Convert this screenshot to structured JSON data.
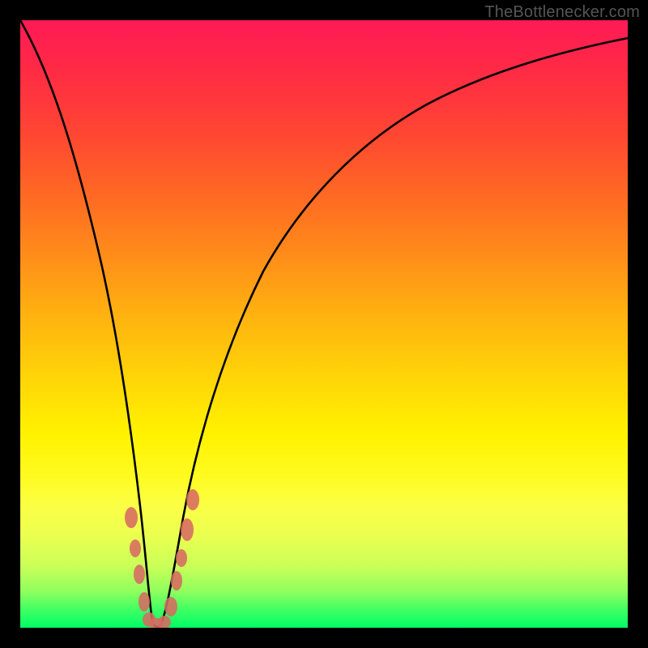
{
  "watermark": "TheBottlenecker.com",
  "chart_data": {
    "type": "line",
    "title": "",
    "xlabel": "",
    "ylabel": "",
    "xlim": [
      0,
      100
    ],
    "ylim": [
      0,
      100
    ],
    "grid": false,
    "legend": null,
    "series": [
      {
        "name": "bottleneck-curve",
        "x": [
          0,
          2,
          5,
          8,
          11,
          14,
          16,
          18,
          19.5,
          20.8,
          22,
          23,
          24,
          26,
          29,
          33,
          38,
          44,
          51,
          59,
          68,
          78,
          89,
          100
        ],
        "y": [
          100,
          90,
          76,
          62,
          48,
          34,
          23,
          12,
          5,
          0.5,
          0.5,
          4,
          10,
          22,
          36,
          50,
          62,
          72,
          79,
          84.5,
          88.5,
          91.8,
          94.2,
          96
        ]
      }
    ],
    "highlight_marks": {
      "color": "#dd7766",
      "points": [
        {
          "x": 17.5,
          "y": 18
        },
        {
          "x": 18.2,
          "y": 12
        },
        {
          "x": 18.8,
          "y": 8
        },
        {
          "x": 19.7,
          "y": 3.5
        },
        {
          "x": 20.2,
          "y": 1
        },
        {
          "x": 21.0,
          "y": 0.7
        },
        {
          "x": 21.8,
          "y": 0.7
        },
        {
          "x": 22.8,
          "y": 2.5
        },
        {
          "x": 23.8,
          "y": 7.5
        },
        {
          "x": 24.4,
          "y": 11
        },
        {
          "x": 25.5,
          "y": 17
        },
        {
          "x": 26.3,
          "y": 22
        }
      ]
    },
    "gradient_bands": [
      {
        "color": "#ff1a55",
        "stop": 0
      },
      {
        "color": "#ffa015",
        "stop": 40
      },
      {
        "color": "#fff200",
        "stop": 68
      },
      {
        "color": "#00ff66",
        "stop": 100
      }
    ]
  }
}
